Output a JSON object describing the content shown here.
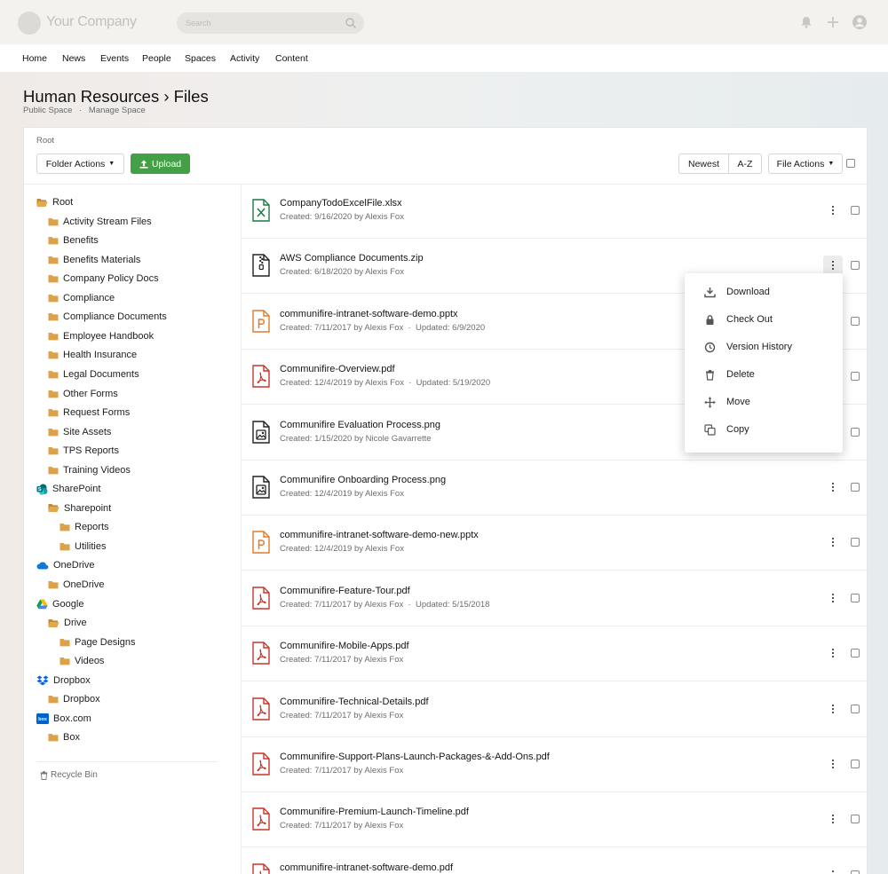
{
  "topbar": {
    "company": "Your Company",
    "search_placeholder": "Search"
  },
  "nav": [
    "Home",
    "News",
    "Events",
    "People",
    "Spaces",
    "Activity",
    "Content"
  ],
  "header": {
    "title": "Human Resources › Files",
    "space_type": "Public Space",
    "separator": "·",
    "manage": "Manage Space"
  },
  "toolbar": {
    "breadcrumb": "Root",
    "folder_actions": "Folder Actions",
    "upload": "Upload",
    "sort_newest": "Newest",
    "sort_az": "A-Z",
    "file_actions": "File Actions"
  },
  "tree": [
    {
      "label": "Root",
      "icon": "folder-open-icon"
    },
    {
      "label": "Activity Stream Files",
      "icon": "folder-icon"
    },
    {
      "label": "Benefits",
      "icon": "folder-icon"
    },
    {
      "label": "Benefits Materials",
      "icon": "folder-icon"
    },
    {
      "label": "Company Policy Docs",
      "icon": "folder-icon"
    },
    {
      "label": "Compliance",
      "icon": "folder-icon"
    },
    {
      "label": "Compliance Documents",
      "icon": "folder-icon"
    },
    {
      "label": "Employee Handbook",
      "icon": "folder-icon"
    },
    {
      "label": "Health Insurance",
      "icon": "folder-icon"
    },
    {
      "label": "Legal Documents",
      "icon": "folder-icon"
    },
    {
      "label": "Other Forms",
      "icon": "folder-icon"
    },
    {
      "label": "Request Forms",
      "icon": "folder-icon"
    },
    {
      "label": "Site Assets",
      "icon": "folder-icon"
    },
    {
      "label": "TPS Reports",
      "icon": "folder-icon"
    },
    {
      "label": "Training Videos",
      "icon": "folder-icon"
    },
    {
      "label": "SharePoint",
      "icon": "sharepoint-icon"
    },
    {
      "label": "Sharepoint",
      "icon": "folder-open-icon"
    },
    {
      "label": "Reports",
      "icon": "folder-icon"
    },
    {
      "label": "Utilities",
      "icon": "folder-icon"
    },
    {
      "label": "OneDrive",
      "icon": "onedrive-icon"
    },
    {
      "label": "OneDrive",
      "icon": "folder-icon"
    },
    {
      "label": "Google",
      "icon": "google-drive-icon"
    },
    {
      "label": "Drive",
      "icon": "folder-open-icon"
    },
    {
      "label": "Page Designs",
      "icon": "folder-icon"
    },
    {
      "label": "Videos",
      "icon": "folder-icon"
    },
    {
      "label": "Dropbox",
      "icon": "dropbox-icon"
    },
    {
      "label": "Dropbox",
      "icon": "folder-icon"
    },
    {
      "label": "Box.com",
      "icon": "box-icon"
    },
    {
      "label": "Box",
      "icon": "folder-icon"
    }
  ],
  "recycle_bin": "Recycle Bin",
  "files": [
    {
      "name": "CompanyTodoExcelFile.xlsx",
      "meta": "Created: 9/16/2020 by Alexis Fox",
      "type": "excel-file-icon"
    },
    {
      "name": "AWS Compliance Documents.zip",
      "meta": "Created: 6/18/2020 by Alexis Fox",
      "type": "zip-file-icon"
    },
    {
      "name": "communifire-intranet-software-demo.pptx",
      "meta": "Created: 7/11/2017 by Alexis Fox  ·  Updated: 6/9/2020",
      "type": "powerpoint-file-icon"
    },
    {
      "name": "Communifire-Overview.pdf",
      "meta": "Created: 12/4/2019 by Alexis Fox  ·  Updated: 5/19/2020",
      "type": "pdf-file-icon"
    },
    {
      "name": "Communifire Evaluation Process.png",
      "meta": "Created: 1/15/2020 by Nicole Gavarrette",
      "type": "image-file-icon"
    },
    {
      "name": "Communifire Onboarding Process.png",
      "meta": "Created: 12/4/2019 by Alexis Fox",
      "type": "image-file-icon"
    },
    {
      "name": "communifire-intranet-software-demo-new.pptx",
      "meta": "Created: 12/4/2019 by Alexis Fox",
      "type": "powerpoint-file-icon"
    },
    {
      "name": "Communifire-Feature-Tour.pdf",
      "meta": "Created: 7/11/2017 by Alexis Fox  ·  Updated: 5/15/2018",
      "type": "pdf-file-icon"
    },
    {
      "name": "Communifire-Mobile-Apps.pdf",
      "meta": "Created: 7/11/2017 by Alexis Fox",
      "type": "pdf-file-icon"
    },
    {
      "name": "Communifire-Technical-Details.pdf",
      "meta": "Created: 7/11/2017 by Alexis Fox",
      "type": "pdf-file-icon"
    },
    {
      "name": "Communifire-Support-Plans-Launch-Packages-&-Add-Ons.pdf",
      "meta": "Created: 7/11/2017 by Alexis Fox",
      "type": "pdf-file-icon"
    },
    {
      "name": "Communifire-Premium-Launch-Timeline.pdf",
      "meta": "Created: 7/11/2017 by Alexis Fox",
      "type": "pdf-file-icon"
    },
    {
      "name": "communifire-intranet-software-demo.pdf",
      "meta": "",
      "type": "pdf-file-icon"
    }
  ],
  "menu": [
    {
      "label": "Download",
      "icon": "download-icon"
    },
    {
      "label": "Check Out",
      "icon": "lock-icon"
    },
    {
      "label": "Version History",
      "icon": "clock-icon"
    },
    {
      "label": "Delete",
      "icon": "trash-icon"
    },
    {
      "label": "Move",
      "icon": "move-icon"
    },
    {
      "label": "Copy",
      "icon": "copy-icon"
    }
  ],
  "colors": {
    "upload_green": "#43a047",
    "folder_orange": "#d9a24a",
    "pdf_red": "#c8352b",
    "excel_green": "#1d7a43",
    "pptx_orange": "#e07b2a"
  }
}
